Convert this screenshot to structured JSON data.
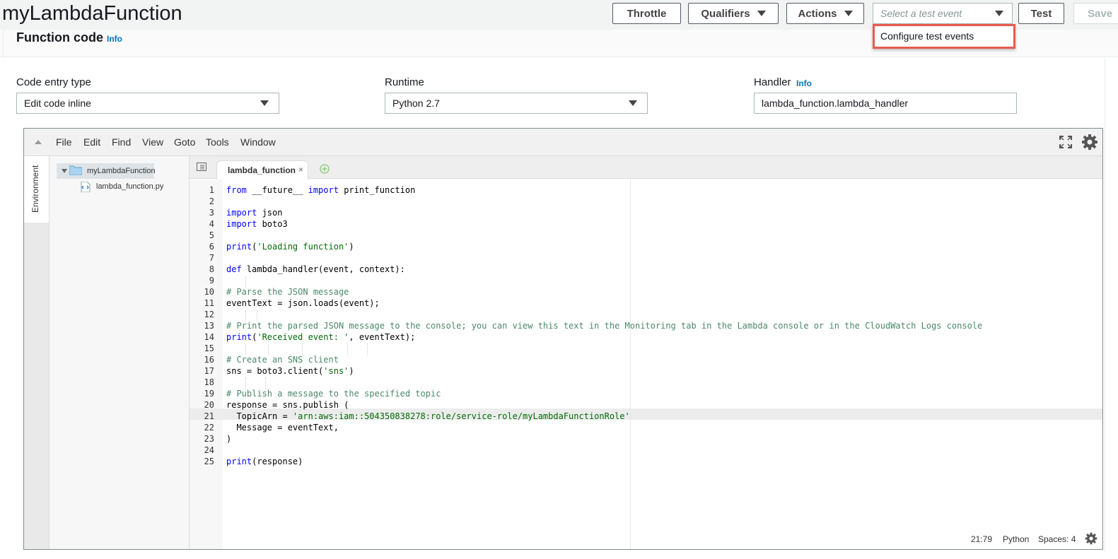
{
  "header": {
    "function_name": "myLambdaFunction",
    "throttle_label": "Throttle",
    "qualifiers_label": "Qualifiers",
    "actions_label": "Actions",
    "test_event_placeholder": "Select a test event",
    "test_label": "Test",
    "save_label": "Save"
  },
  "dropdown": {
    "items": [
      "Configure test events"
    ]
  },
  "section": {
    "title": "Function code",
    "info_label": "Info"
  },
  "form": {
    "code_entry_label": "Code entry type",
    "code_entry_value": "Edit code inline",
    "runtime_label": "Runtime",
    "runtime_value": "Python 2.7",
    "handler_label": "Handler",
    "handler_info": "Info",
    "handler_value": "lambda_function.lambda_handler"
  },
  "editor": {
    "menu": [
      "File",
      "Edit",
      "Find",
      "View",
      "Goto",
      "Tools",
      "Window"
    ],
    "environment_label": "Environment",
    "tree": {
      "root": "myLambdaFunction",
      "file": "lambda_function.py"
    },
    "tab": {
      "label": "lambda_function",
      "close": "×"
    },
    "line_numbers": [
      "1",
      "2",
      "3",
      "4",
      "5",
      "6",
      "7",
      "8",
      "9",
      "10",
      "11",
      "12",
      "13",
      "14",
      "15",
      "16",
      "17",
      "18",
      "19",
      "20",
      "21",
      "22",
      "23",
      "24",
      "25"
    ],
    "code": {
      "l1_kw1": "from",
      "l1_mid": " __future__ ",
      "l1_kw2": "import",
      "l1_rest": " print_function",
      "l3_kw": "import",
      "l3_rest": " json",
      "l4_kw": "import",
      "l4_rest": " boto3",
      "l6_kw": "print",
      "l6_p1": "(",
      "l6_str": "'Loading function'",
      "l6_p2": ")",
      "l8_kw": "def",
      "l8_rest": " lambda_handler(event, context):",
      "l10_cm": "# Parse the JSON message",
      "l11": "eventText = json.loads(event);",
      "l13_cm": "# Print the parsed JSON message to the console; you can view this text in the Monitoring tab in the Lambda console or in the CloudWatch Logs console",
      "l14_kw": "print",
      "l14_p1": "(",
      "l14_str": "'Received event: '",
      "l14_rest": ", eventText);",
      "l16_cm": "# Create an SNS client",
      "l17_pre": "sns = boto3.client(",
      "l17_str": "'sns'",
      "l17_post": ")",
      "l19_cm": "# Publish a message to the specified topic",
      "l20": "response = sns.publish (",
      "l21_pre": "  TopicArn = ",
      "l21_str": "'arn:aws:iam::504350838278:role/service-role/myLambdaFunctionRole'",
      "l22": "  Message = eventText,",
      "l23": ")",
      "l25_kw": "print",
      "l25_rest": "(response)"
    },
    "status": {
      "position": "21:79",
      "language": "Python",
      "spaces": "Spaces: 4"
    }
  },
  "colors": {
    "accent_info": "#0073bb",
    "highlight_border": "#e85a4f",
    "keyword": "#0000ff",
    "string": "#036a07",
    "comment": "#4c886b"
  }
}
